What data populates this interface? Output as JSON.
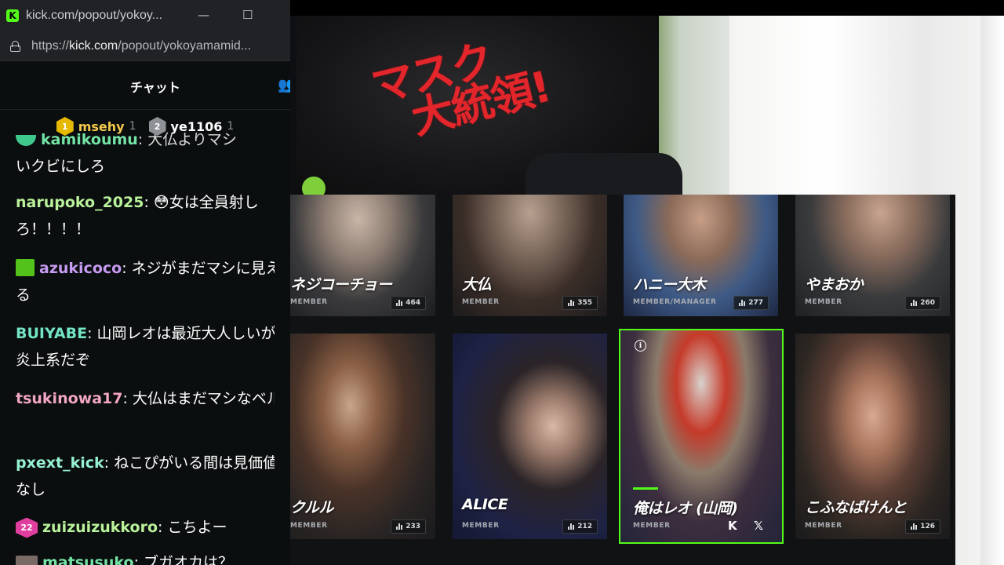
{
  "window": {
    "title": "kick.com/popout/yokoy...",
    "minimize_glyph": "—",
    "maximize_glyph": "☐",
    "url_prefix": "https://",
    "url_host": "kick.com",
    "url_path": "/popout/yokoyamamid...",
    "logo_letter": "K"
  },
  "scene": {
    "shirt_text_line1": "マスク",
    "shirt_text_line2": "大統領!"
  },
  "chat": {
    "tab_chat": "チャット",
    "tab_users_glyph": "👥",
    "leaderboard": [
      {
        "rank": "1",
        "name": "msehy",
        "count": "1",
        "color": "#e6b800",
        "name_color": "#f2c94c"
      },
      {
        "rank": "2",
        "name": "ye1106",
        "count": "1",
        "color": "#8e9196",
        "name_color": "#ffffff"
      }
    ],
    "messages": [
      {
        "user": "",
        "text": "いクビにしろ",
        "user_color": "#73e4a5"
      },
      {
        "user": "narupoko_2025",
        "emote": "😳",
        "text": "女は全員射しろ！！！！",
        "user_color": "#b9f29a"
      },
      {
        "user": "azukicoco",
        "badge": "gift",
        "text": "ネジがまだマシに見える",
        "user_color": "#c79bf2"
      },
      {
        "user": "BUIYABE",
        "text": "山岡レオは最近大人しいが炎上系だぞ",
        "user_color": "#73e4c4"
      },
      {
        "user": "tsukinowa17",
        "text": "大仏はまだマシなベル",
        "user_color": "#f2a6c5"
      },
      {
        "user": "pxext_kick",
        "text": "ねこぴがいる間は見価値なし",
        "user_color": "#96f2d2"
      },
      {
        "user": "zuizuizukkoro",
        "badge": "22",
        "text": "こちよー",
        "user_color": "#b9f29a"
      },
      {
        "user": "matsusuko",
        "text": "ブガオカは？",
        "user_color": "#73e4a5"
      }
    ]
  },
  "members": [
    {
      "name": "ネジコーチョー",
      "role": "MEMBER",
      "views": "464"
    },
    {
      "name": "大仏",
      "role": "MEMBER",
      "views": "355"
    },
    {
      "name": "ハニー大木",
      "role": "MEMBER/MANAGER",
      "views": "277"
    },
    {
      "name": "やまおか",
      "role": "MEMBER",
      "views": "260"
    },
    {
      "name": "クルル",
      "role": "MEMBER",
      "views": "233"
    },
    {
      "name": "ALICE",
      "role": "MEMBER",
      "views": "212"
    },
    {
      "name": "俺はレオ (山岡)",
      "role": "MEMBER",
      "views": "",
      "active": true,
      "info_glyph": "i",
      "social_kick": "K",
      "social_x": "𝕏"
    },
    {
      "name": "こふなばけんと",
      "role": "MEMBER",
      "views": "126"
    }
  ],
  "colors": {
    "kick_green": "#53fc18"
  }
}
